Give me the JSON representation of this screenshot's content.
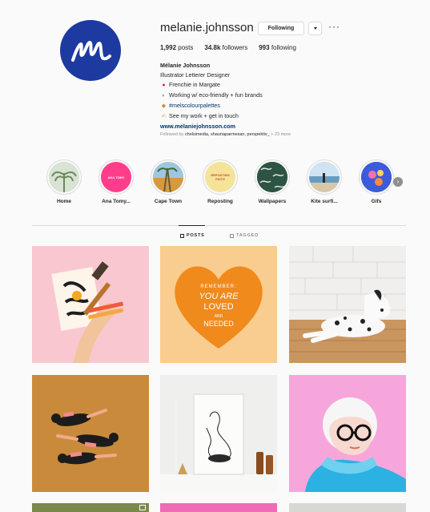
{
  "profile": {
    "username": "melanie.johnsson",
    "following_button": "Following",
    "more_icon": "ellipsis-icon",
    "stats": {
      "posts_count": "1,992",
      "posts_label": "posts",
      "followers_count": "34.8k",
      "followers_label": "followers",
      "following_count": "993",
      "following_label": "following"
    },
    "bio": {
      "name": "Mélanie Johnsson",
      "line1": "Illustrator Letterer Designer",
      "line2": "Frenchie in Margate",
      "line3": "Working w/ eco-friendly + fun brands",
      "line4": "#melscolourpalettes",
      "line5": "See my work + get in touch",
      "website": "www.melaniejohnsson.com"
    },
    "followed_by": {
      "prefix": "Followed by",
      "names": "chelsimedia, shaunaparmesan, perspektiv_",
      "more": "+ 23 more"
    }
  },
  "highlights": [
    {
      "label": "Home"
    },
    {
      "label": "Ana Tomy..."
    },
    {
      "label": "Cape Town"
    },
    {
      "label": "Reposting"
    },
    {
      "label": "Wallpapers"
    },
    {
      "label": "Kite surfi..."
    },
    {
      "label": "Gifs"
    }
  ],
  "highlight_texts": {
    "reposting_cover": "REPOSTING FAITH",
    "ana_cover": "ANA TOMY"
  },
  "tabs": {
    "posts": "POSTS",
    "tagged": "TAGGED"
  },
  "posts": {
    "heart_text1": "REMEMBER:",
    "heart_text2": "YOU ARE",
    "heart_text3": "LOVED",
    "heart_text4": "AND",
    "heart_text5": "NEEDED"
  },
  "colors": {
    "accent": "#1d3aa0",
    "link": "#003569",
    "border": "#dbdbdb",
    "muted": "#8e8e8e"
  }
}
